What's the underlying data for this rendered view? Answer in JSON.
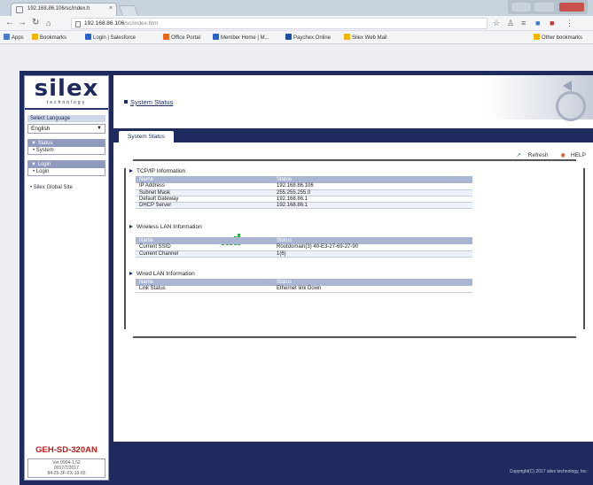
{
  "browser": {
    "tab_title": "192.168.86.106/sc/index.h",
    "tab_close": "×",
    "url_host": "192.168.86.106",
    "url_path": "/sc/index.htm",
    "bookmarks": [
      {
        "label": "Apps",
        "color": "#4a7bd1"
      },
      {
        "label": "Bookmarks",
        "color": "#f4b400"
      },
      {
        "label": "Login | Salesforce",
        "color": "#2a62c9"
      },
      {
        "label": "Office Portal",
        "color": "#e5661c"
      },
      {
        "label": "Member Home | M...",
        "color": "#2a62c9"
      },
      {
        "label": "Paychex Online",
        "color": "#1e4fa3"
      },
      {
        "label": "Silex Web Mail",
        "color": "#f4b400"
      }
    ],
    "other_bookmarks": "Other bookmarks"
  },
  "sidebar": {
    "logo_text": "silex",
    "logo_sub": "technology",
    "language_label": "Select Language",
    "language_value": "English",
    "sections": [
      {
        "head": "▼ Status",
        "item": "• System"
      },
      {
        "head": "▼ Login",
        "item": "• Login"
      }
    ],
    "global_link": "• Silex Global Site",
    "model": "GEH-SD-320AN",
    "fw_lines": [
      "Ver 0904-1.52",
      "0017/7/2017",
      "84-25-3F-XX-19-65"
    ]
  },
  "content": {
    "page_title": "System Status",
    "tab_label": "System Status",
    "refresh_label": "Refresh",
    "help_label": "HELP",
    "sections": [
      {
        "title": "TCP/IP Information",
        "headers": [
          "Name",
          "Status"
        ],
        "rows": [
          [
            "IP Address",
            "192.168.86.106"
          ],
          [
            "Subnet Mask",
            "255.255.255.0"
          ],
          [
            "Default Gateway",
            "192.168.86.1"
          ],
          [
            "DHCP Server",
            "192.168.86.1"
          ]
        ]
      },
      {
        "title": "Wireless LAN Information",
        "headers": [
          "Name",
          "Status"
        ],
        "rows": [
          [
            "Current SSID",
            "Rootdomain(3)  40-E3-27-69-27-90"
          ],
          [
            "Current Channel",
            "1(6)"
          ]
        ]
      },
      {
        "title": "Wired LAN Information",
        "headers": [
          "Name",
          "Status"
        ],
        "rows": [
          [
            "Link Status",
            "Ethernet link Down"
          ]
        ]
      }
    ],
    "signal_strength": 5,
    "copyright": "Copyright(C) 2017 silex technology, Inc."
  }
}
